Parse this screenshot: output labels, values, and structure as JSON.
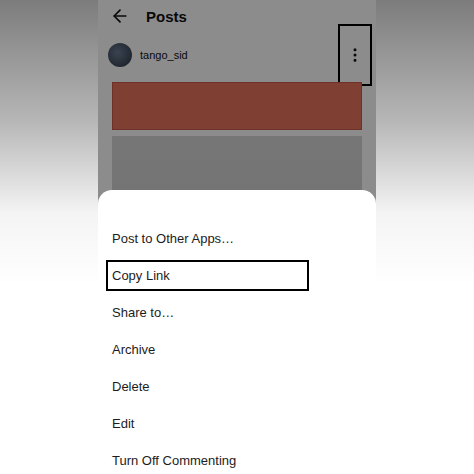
{
  "header": {
    "title": "Posts"
  },
  "post": {
    "username": "tango_sid",
    "more_button": {
      "highlighted": true
    }
  },
  "menu": {
    "items": [
      {
        "label": "Post to Other Apps…",
        "highlighted": false
      },
      {
        "label": "Copy Link",
        "highlighted": true
      },
      {
        "label": "Share to…",
        "highlighted": false
      },
      {
        "label": "Archive",
        "highlighted": false
      },
      {
        "label": "Delete",
        "highlighted": false
      },
      {
        "label": "Edit",
        "highlighted": false
      },
      {
        "label": "Turn Off Commenting",
        "highlighted": false
      }
    ]
  }
}
